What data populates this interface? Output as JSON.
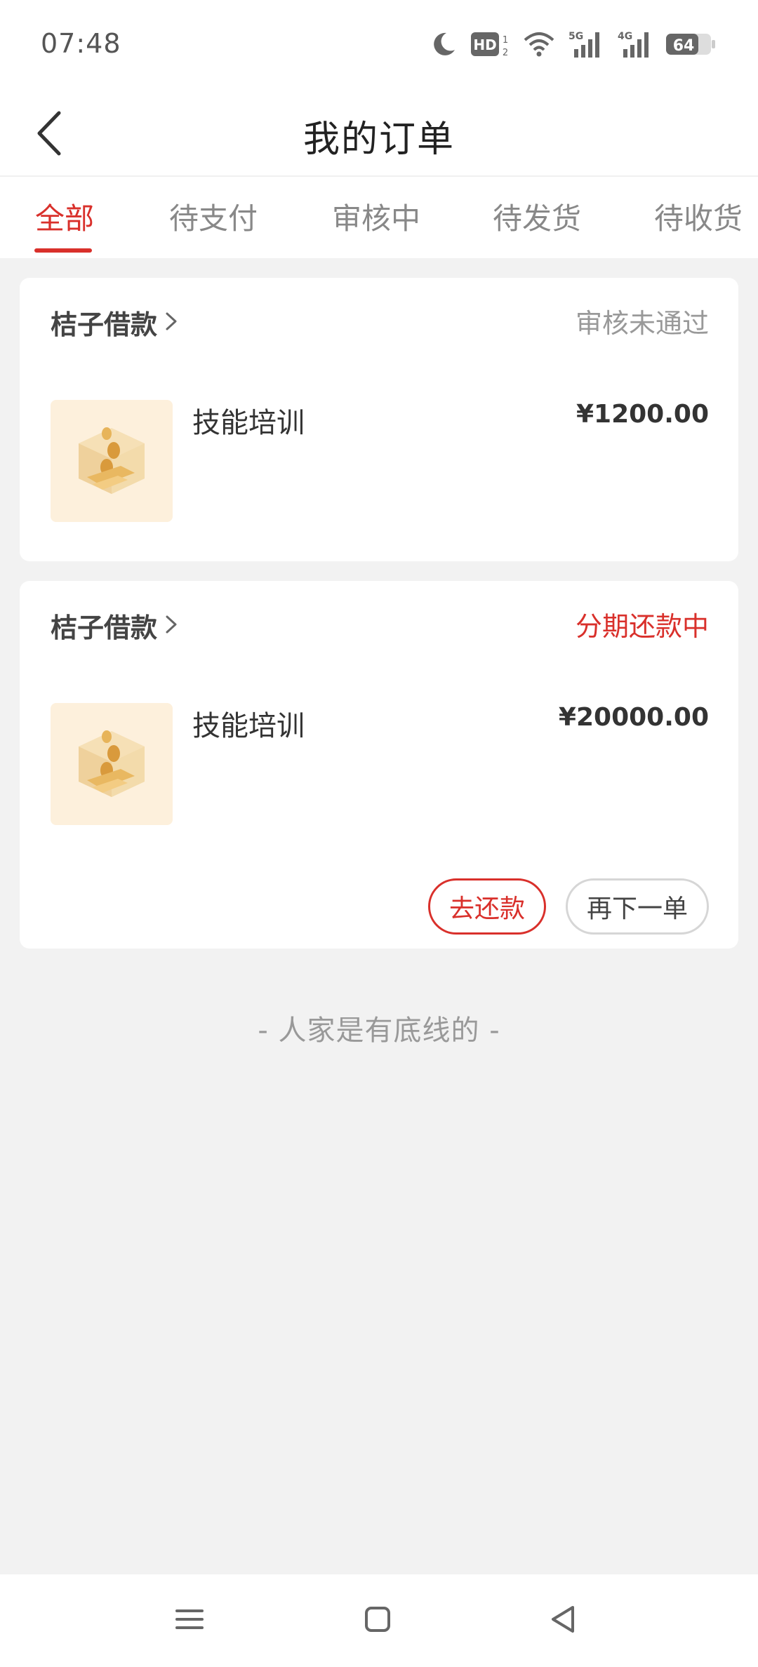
{
  "status_bar": {
    "time": "07:48",
    "icons": [
      "moon-icon",
      "hd-icon",
      "wifi-icon",
      "signal-5g-icon",
      "signal-4g-icon",
      "battery-icon"
    ],
    "hd_label": "HD",
    "label_5g": "5G",
    "label_4g": "4G",
    "battery_level": "64"
  },
  "header": {
    "title": "我的订单",
    "back_icon": "chevron-left-icon"
  },
  "tabs": [
    {
      "label": "全部",
      "active": true
    },
    {
      "label": "待支付",
      "active": false
    },
    {
      "label": "审核中",
      "active": false
    },
    {
      "label": "待发货",
      "active": false
    },
    {
      "label": "待收货",
      "active": false
    }
  ],
  "orders": [
    {
      "shop": "桔子借款",
      "status": "审核未通过",
      "product": "技能培训",
      "price": "¥1200.00",
      "buttons": []
    },
    {
      "shop": "桔子借款",
      "status": "分期还款中",
      "product": "技能培训",
      "price": "¥20000.00",
      "buttons": [
        "去还款",
        "再下一单"
      ]
    }
  ],
  "footer_note": "- 人家是有底线的 -",
  "nav_bar": {
    "icons": [
      "menu-icon",
      "home-icon",
      "back-icon"
    ]
  },
  "colors": {
    "accent": "#d9302b",
    "background": "#f2f2f2",
    "thumb_bg": "#fdf0dc"
  }
}
